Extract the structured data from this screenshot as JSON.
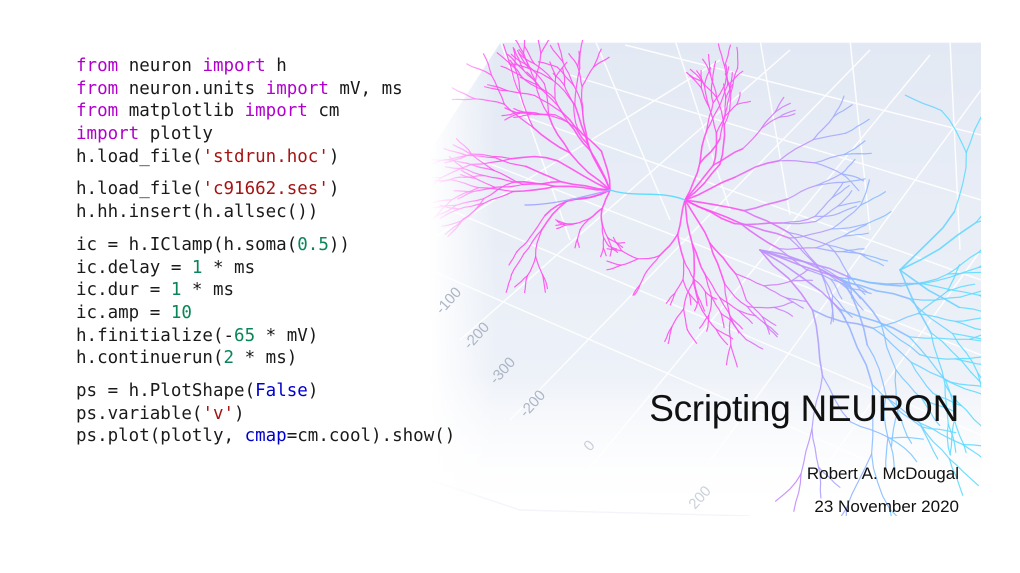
{
  "slide": {
    "title": "Scripting NEURON",
    "author": "Robert A. McDougal",
    "date": "23 November 2020"
  },
  "code": {
    "language": "python",
    "lines": [
      [
        {
          "t": "from",
          "c": "kw"
        },
        {
          "t": " neuron "
        },
        {
          "t": "import",
          "c": "kw"
        },
        {
          "t": " h"
        }
      ],
      [
        {
          "t": "from",
          "c": "kw"
        },
        {
          "t": " neuron.units "
        },
        {
          "t": "import",
          "c": "kw"
        },
        {
          "t": " mV, ms"
        }
      ],
      [
        {
          "t": "from",
          "c": "kw"
        },
        {
          "t": " matplotlib "
        },
        {
          "t": "import",
          "c": "kw"
        },
        {
          "t": " cm"
        }
      ],
      [
        {
          "t": "import",
          "c": "kw"
        },
        {
          "t": " plotly"
        }
      ],
      [
        {
          "t": "h.load_file("
        },
        {
          "t": "'stdrun.hoc'",
          "c": "str"
        },
        {
          "t": ")"
        }
      ],
      "gap",
      [
        {
          "t": "h.load_file("
        },
        {
          "t": "'c91662.ses'",
          "c": "str"
        },
        {
          "t": ")"
        }
      ],
      [
        {
          "t": "h.hh.insert(h.allsec())"
        }
      ],
      "gap",
      [
        {
          "t": "ic = h.IClamp(h.soma("
        },
        {
          "t": "0.5",
          "c": "num"
        },
        {
          "t": "))"
        }
      ],
      [
        {
          "t": "ic.delay = "
        },
        {
          "t": "1",
          "c": "num"
        },
        {
          "t": " * ms"
        }
      ],
      [
        {
          "t": "ic.dur = "
        },
        {
          "t": "1",
          "c": "num"
        },
        {
          "t": " * ms"
        }
      ],
      [
        {
          "t": "ic.amp = "
        },
        {
          "t": "10",
          "c": "num"
        }
      ],
      [
        {
          "t": "h.finitialize(-"
        },
        {
          "t": "65",
          "c": "num"
        },
        {
          "t": " * mV)"
        }
      ],
      [
        {
          "t": "h.continuerun("
        },
        {
          "t": "2",
          "c": "num"
        },
        {
          "t": " * ms)"
        }
      ],
      "gap",
      [
        {
          "t": "ps = h.PlotShape("
        },
        {
          "t": "False",
          "c": "bool"
        },
        {
          "t": ")"
        }
      ],
      [
        {
          "t": "ps.variable("
        },
        {
          "t": "'v'",
          "c": "str"
        },
        {
          "t": ")"
        }
      ],
      [
        {
          "t": "ps.plot(plotly, "
        },
        {
          "t": "cmap",
          "c": "param"
        },
        {
          "t": "=cm.cool).show()"
        }
      ]
    ]
  },
  "plot": {
    "type": "3d-morphology",
    "colormap": "cool",
    "colors": {
      "high": "#ff4ff0",
      "mid": "#a7a9ff",
      "low": "#5fdcff",
      "pane": "#e6ebf5",
      "grid": "#ffffff",
      "tick_label": "#a9b2c3"
    },
    "tick_labels": [
      "-100",
      "-200",
      "-300",
      "-200",
      "0",
      "200"
    ]
  }
}
